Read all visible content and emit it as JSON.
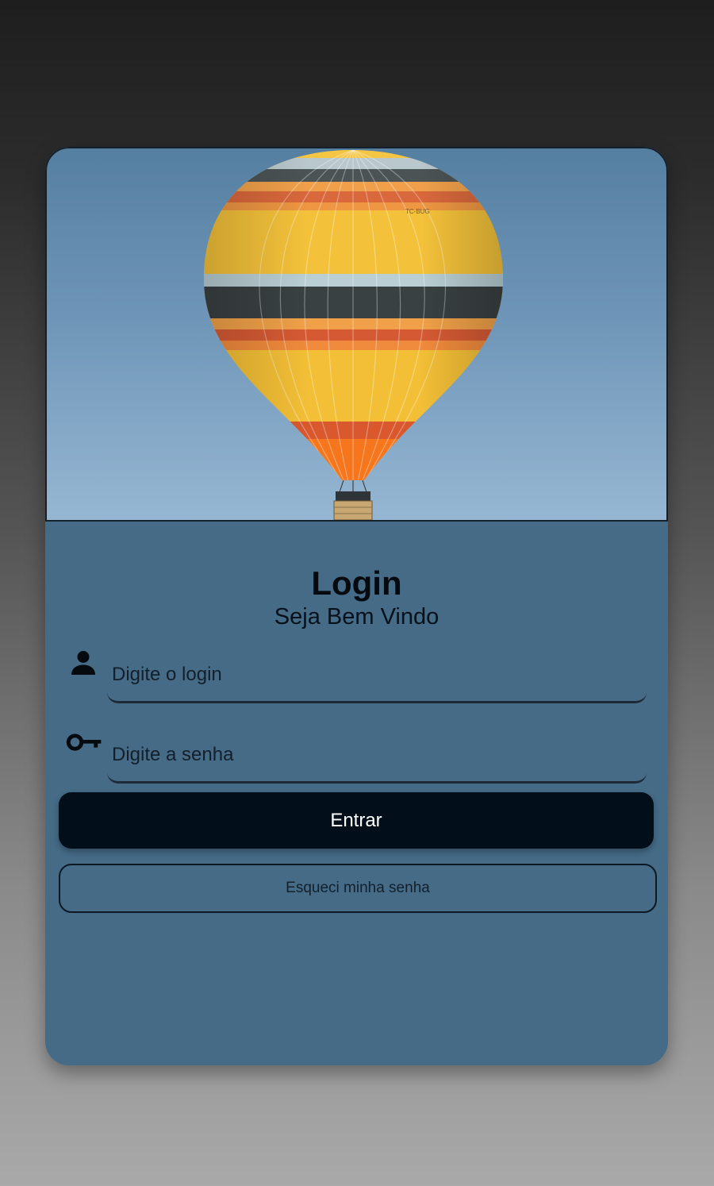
{
  "header": {
    "title": "Login",
    "subtitle": "Seja Bem Vindo"
  },
  "hero": {
    "image": "hot-air-balloon-photo",
    "balloon_marking": "TC-BUG"
  },
  "form": {
    "login": {
      "icon": "person-icon",
      "placeholder": "Digite o login",
      "value": ""
    },
    "password": {
      "icon": "key-icon",
      "placeholder": "Digite a senha",
      "value": ""
    }
  },
  "actions": {
    "submit_label": "Entrar",
    "forgot_label": "Esqueci minha senha"
  },
  "colors": {
    "card_background": "#456b87",
    "primary_button": "#020f1a",
    "sky_top": "#557fa1",
    "sky_bottom": "#96b7d3"
  }
}
